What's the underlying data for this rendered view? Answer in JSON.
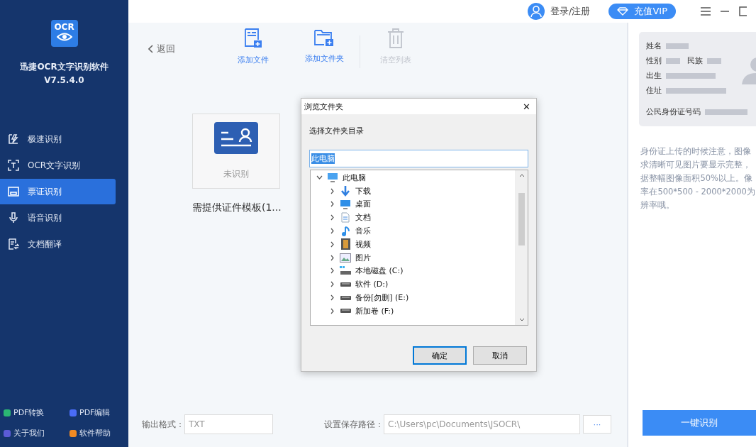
{
  "app": {
    "logo_text": "OCR",
    "name": "迅捷OCR文字识别软件",
    "version": "V7.5.4.0"
  },
  "sidebar": {
    "items": [
      {
        "label": "极速识别",
        "selected": false
      },
      {
        "label": "OCR文字识别",
        "selected": false
      },
      {
        "label": "票证识别",
        "selected": true
      },
      {
        "label": "语音识别",
        "selected": false
      },
      {
        "label": "文档翻译",
        "selected": false
      }
    ],
    "footer_links": [
      {
        "label": "PDF转换",
        "color": "#2bb673"
      },
      {
        "label": "PDF编辑",
        "color": "#4a6cf7"
      },
      {
        "label": "关于我们",
        "color": "#5b5bd6"
      },
      {
        "label": "软件帮助",
        "color": "#f08a24"
      }
    ]
  },
  "header": {
    "account": "登录/注册",
    "vip": "充值VIP"
  },
  "toolbar": {
    "back": "返回",
    "actions": [
      {
        "label": "添加文件",
        "disabled": false
      },
      {
        "label": "添加文件夹",
        "disabled": false
      },
      {
        "label": "清空列表",
        "disabled": true
      }
    ]
  },
  "file_card": {
    "status": "未识别",
    "name": "需提供证件模板(1..."
  },
  "bottom": {
    "format_label": "输出格式：",
    "format": "TXT",
    "path_label": "设置保存路径：",
    "path": "C:\\Users\\pc\\Documents\\JSOCR\\",
    "browse": "···"
  },
  "right_panel": {
    "card_fields": [
      "姓名",
      "性别",
      "民族",
      "出生",
      "住址",
      "公民身份证号码"
    ],
    "tip_lines": [
      "身份证上传的时候注意，图像",
      "求清晰可见图片要显示完整，",
      "据整幅图像面积50%以上。像",
      "率在500*500 - 2000*2000为",
      "辨率哦。"
    ],
    "action": "一键识别"
  },
  "dialog": {
    "title": "浏览文件夹",
    "close": "✕",
    "prompt": "选择文件夹目录",
    "path": "此电脑",
    "tree": [
      {
        "label": "此电脑",
        "expanded": true,
        "children": [
          {
            "label": "下载",
            "expanded": false
          },
          {
            "label": "桌面",
            "expanded": false
          },
          {
            "label": "文档",
            "expanded": false
          },
          {
            "label": "音乐",
            "expanded": false
          },
          {
            "label": "视频",
            "expanded": false
          },
          {
            "label": "图片",
            "expanded": false
          },
          {
            "label": "本地磁盘 (C:)",
            "expanded": false
          },
          {
            "label": "软件 (D:)",
            "expanded": false
          },
          {
            "label": "备份[勿删] (E:)",
            "expanded": false
          },
          {
            "label": "新加卷 (F:)",
            "expanded": false
          }
        ]
      }
    ],
    "buttons": [
      {
        "label": "确定",
        "default": true
      },
      {
        "label": "取消",
        "default": false
      }
    ]
  }
}
